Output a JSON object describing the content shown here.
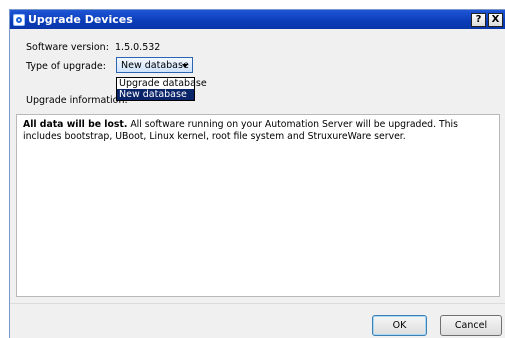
{
  "window": {
    "title": "Upgrade Devices",
    "help_button": "?",
    "close_button": "X"
  },
  "form": {
    "software_version_label": "Software version:",
    "software_version_value": "1.5.0.532",
    "upgrade_type_label": "Type of upgrade:",
    "upgrade_type_selected": "New database",
    "upgrade_info_label": "Upgrade information:",
    "upgrade_type_options": [
      "Upgrade database",
      "New database"
    ]
  },
  "info": {
    "bold_text": "All data will be lost.",
    "body_text": " All software running on your Automation Server will be upgraded. This includes bootstrap, UBoot, Linux kernel, root file system and StruxureWare server."
  },
  "buttons": {
    "ok_label": "OK",
    "cancel_label": "Cancel"
  },
  "colors": {
    "titlebar": "#0a3cb8",
    "selection": "#0a246a"
  }
}
